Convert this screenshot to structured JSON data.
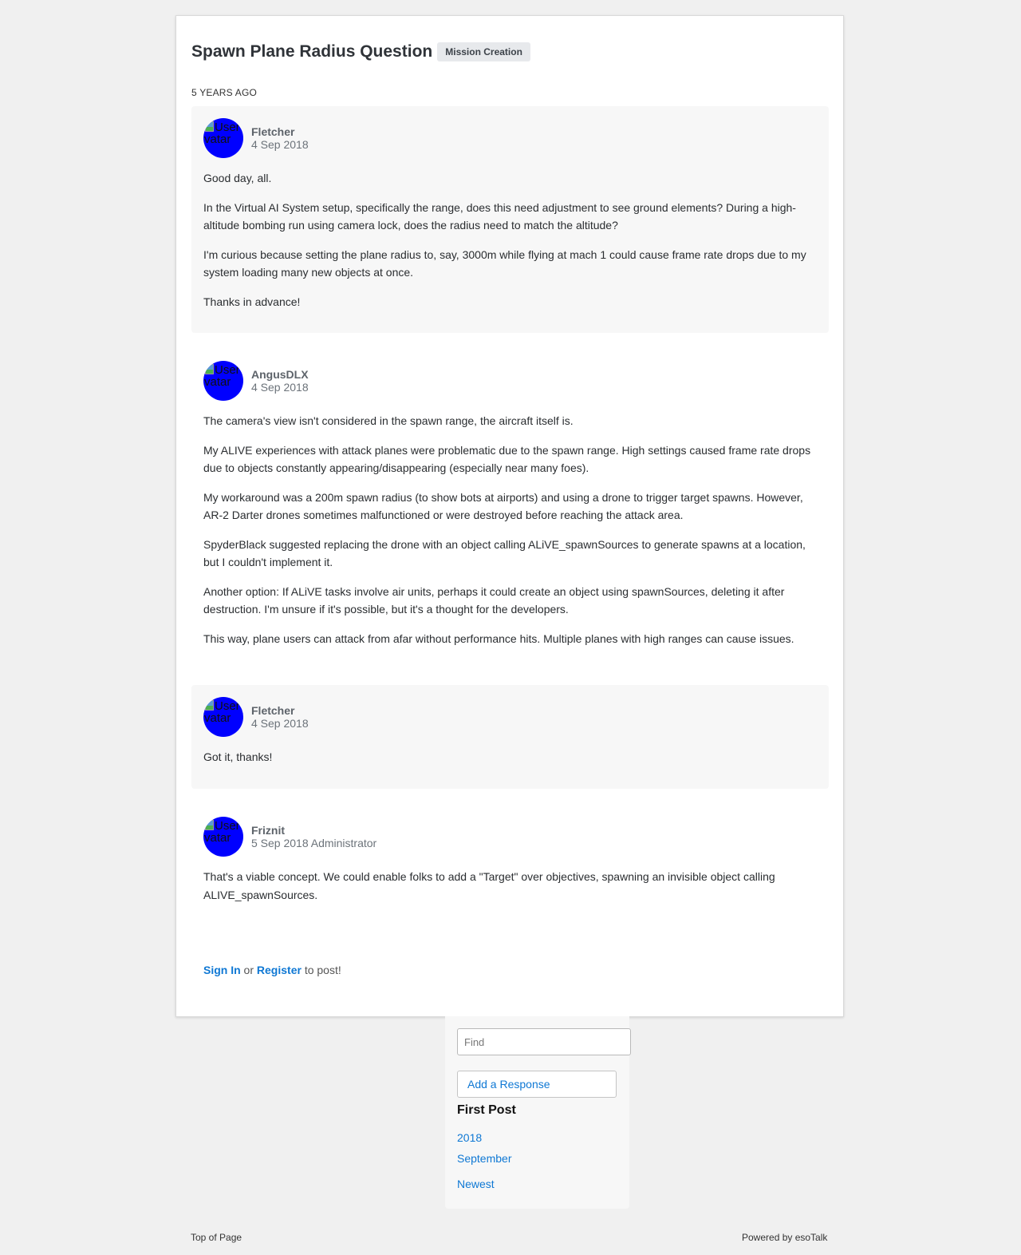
{
  "thread": {
    "title": "Spawn Plane Radius Question",
    "tag": "Mission Creation",
    "time_marker": "5 YEARS AGO"
  },
  "avatar_alt": "User Avatar",
  "posts": [
    {
      "author": "Fletcher",
      "date": "4 Sep 2018",
      "paragraphs": [
        "Good day, all.",
        "In the Virtual AI System setup, specifically the range, does this need adjustment to see ground elements? During a high-altitude bombing run using camera lock, does the radius need to match the altitude?",
        "I'm curious because setting the plane radius to, say, 3000m while flying at mach 1 could cause frame rate drops due to my system loading many new objects at once.",
        "Thanks in advance!"
      ]
    },
    {
      "author": "AngusDLX",
      "date": "4 Sep 2018",
      "paragraphs": [
        "The camera's view isn't considered in the spawn range, the aircraft itself is.",
        "My ALIVE experiences with attack planes were problematic due to the spawn range. High settings caused frame rate drops due to objects constantly appearing/disappearing (especially near many foes).",
        "My workaround was a 200m spawn radius (to show bots at airports) and using a drone to trigger target spawns. However, AR-2 Darter drones sometimes malfunctioned or were destroyed before reaching the attack area.",
        "SpyderBlack suggested replacing the drone with an object calling ALiVE_spawnSources to generate spawns at a location, but I couldn't implement it.",
        "Another option: If ALiVE tasks involve air units, perhaps it could create an object using spawnSources, deleting it after destruction. I'm unsure if it's possible, but it's a thought for the developers.",
        "This way, plane users can attack from afar without performance hits. Multiple planes with high ranges can cause issues."
      ]
    },
    {
      "author": "Fletcher",
      "date": "4 Sep 2018",
      "paragraphs": [
        "Got it, thanks!"
      ]
    },
    {
      "author": "Friznit",
      "date": "5 Sep 2018 Administrator",
      "paragraphs": [
        "That's a viable concept. We could enable folks to add a \"Target\" over objectives, spawning an invisible object calling ALIVE_spawnSources."
      ]
    }
  ],
  "signin": {
    "sign_in": "Sign In",
    "or": " or ",
    "register": "Register",
    "suffix": " to post!"
  },
  "sidebar": {
    "find_placeholder": "Find",
    "add_response": "Add a Response",
    "first_post": "First Post",
    "year": "2018",
    "month": "September",
    "newest": "Newest"
  },
  "footer": {
    "top_of_page": "Top of Page",
    "powered_by": "Powered by esoTalk"
  },
  "colors": {
    "page_bg": "#f0f0f0",
    "card_bg": "#ffffff",
    "shaded_post_bg": "#f7f7f7",
    "link": "#0f78d4",
    "avatar": "#0000ff"
  }
}
